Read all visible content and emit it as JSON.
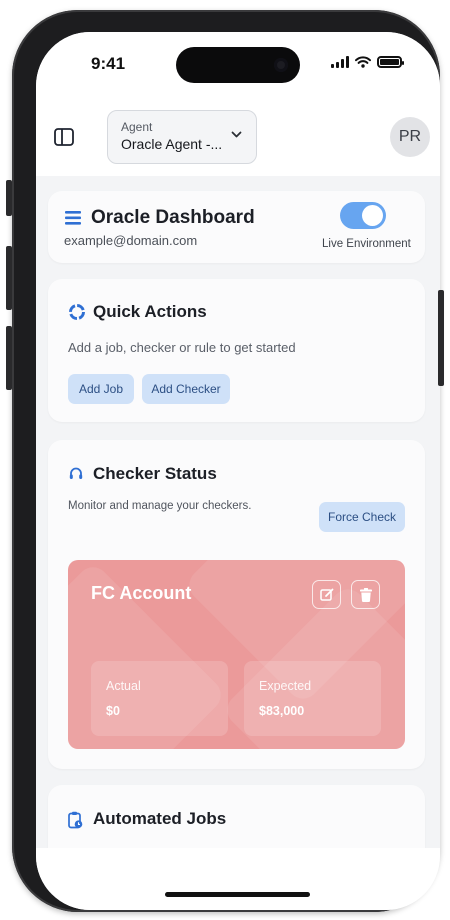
{
  "status_bar": {
    "time": "9:41"
  },
  "app_bar": {
    "agent_label": "Agent",
    "agent_value": "Oracle Agent -...",
    "avatar_initials": "PR"
  },
  "dashboard": {
    "title": "Oracle Dashboard",
    "email": "example@domain.com",
    "toggle_label": "Live Environment",
    "toggle_on": true
  },
  "quick_actions": {
    "title": "Quick Actions",
    "subtitle": "Add a job, checker or rule to get started",
    "add_job_label": "Add Job",
    "add_checker_label": "Add Checker"
  },
  "checker_status": {
    "title": "Checker Status",
    "subtitle": "Monitor and manage your checkers.",
    "force_check_label": "Force Check",
    "checker": {
      "name": "FC Account",
      "actual_label": "Actual",
      "actual_value": "$0",
      "expected_label": "Expected",
      "expected_value": "$83,000",
      "color": "#eb9a9a"
    }
  },
  "automated_jobs": {
    "title": "Automated Jobs"
  },
  "colors": {
    "accent": "#67a5f0",
    "button_bg": "#cfe1f8",
    "button_text": "#2c4f84",
    "icon_blue": "#2f6fd3"
  }
}
